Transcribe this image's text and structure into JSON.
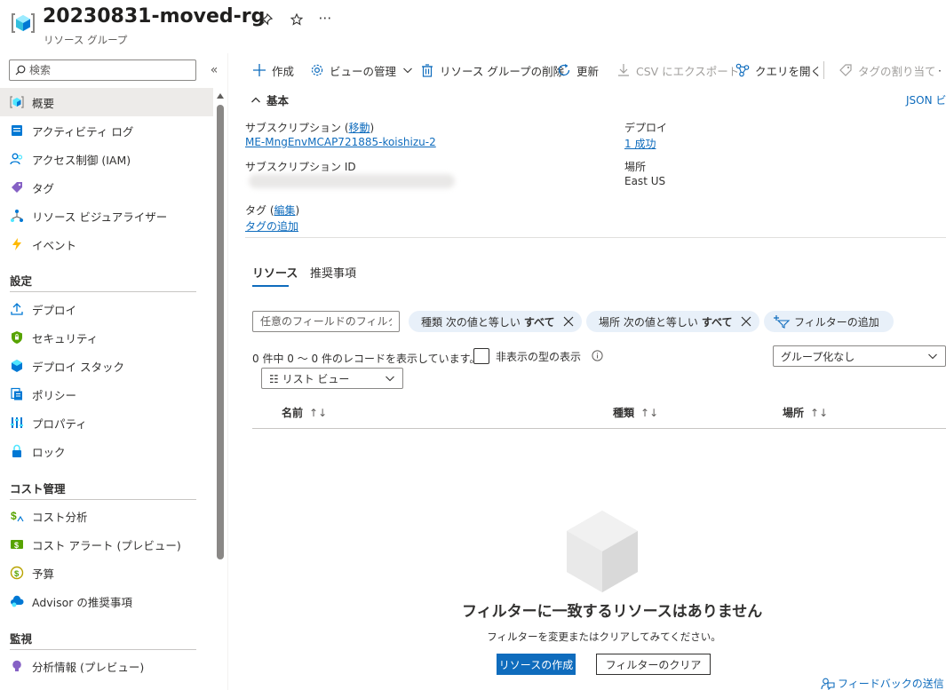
{
  "header": {
    "title": "20230831-moved-rg",
    "subtitle": "リソース グループ",
    "more": "⋯"
  },
  "sidebar": {
    "search_placeholder": "検索",
    "collapse": "«",
    "items": [
      {
        "label": "概要"
      },
      {
        "label": "アクティビティ ログ"
      },
      {
        "label": "アクセス制御 (IAM)"
      },
      {
        "label": "タグ"
      },
      {
        "label": "リソース ビジュアライザー"
      },
      {
        "label": "イベント"
      }
    ],
    "sections": [
      {
        "title": "設定",
        "items": [
          {
            "label": "デプロイ"
          },
          {
            "label": "セキュリティ"
          },
          {
            "label": "デプロイ スタック"
          },
          {
            "label": "ポリシー"
          },
          {
            "label": "プロパティ"
          },
          {
            "label": "ロック"
          }
        ]
      },
      {
        "title": "コスト管理",
        "items": [
          {
            "label": "コスト分析"
          },
          {
            "label": "コスト アラート (プレビュー)"
          },
          {
            "label": "予算"
          },
          {
            "label": "Advisor の推奨事項"
          }
        ]
      },
      {
        "title": "監視",
        "items": [
          {
            "label": "分析情報 (プレビュー)"
          }
        ]
      }
    ]
  },
  "toolbar": {
    "create": "作成",
    "manage_view": "ビューの管理",
    "delete_rg": "リソース グループの削除",
    "refresh": "更新",
    "export_csv": "CSV にエクスポート",
    "open_query": "クエリを開く",
    "assign_tags": "タグの割り当て",
    "more": "·"
  },
  "essentials": {
    "toggle_label": "基本",
    "json_view": "JSON ビ",
    "subscription_label": "サブスクリプション (",
    "subscription_move": "移動",
    "subscription_label_end": ")",
    "subscription_value": "ME-MngEnvMCAP721885-koishizu-2",
    "subscription_id_label": "サブスクリプション ID",
    "tags_label": "タグ (",
    "tags_edit": "編集",
    "tags_label_end": ")",
    "tags_add": "タグの追加",
    "deploy_label": "デプロイ",
    "deploy_value": "1 成功",
    "location_label": "場所",
    "location_value": "East US"
  },
  "tabs": [
    "リソース",
    "推奨事項"
  ],
  "filters": {
    "field_placeholder": "任意のフィールドのフィルター...",
    "pill_type": {
      "prefix": "種類 次の値と等しい",
      "value": "すべて"
    },
    "pill_location": {
      "prefix": "場所 次の値と等しい",
      "value": "すべて"
    },
    "add_filter": "フィルターの追加"
  },
  "list": {
    "records_text": "0 件中 0 ～ 0 件のレコードを表示しています。",
    "show_hidden": "非表示の型の表示",
    "grouping": "グループ化なし",
    "view_mode": "☷ リスト ビュー",
    "columns": [
      {
        "label": "名前",
        "arrow": "↑↓"
      },
      {
        "label": "種類",
        "arrow": "↑↓"
      },
      {
        "label": "場所",
        "arrow": "↑↓"
      }
    ]
  },
  "empty_state": {
    "title": "フィルターに一致するリソースはありません",
    "subtitle": "フィルターを変更またはクリアしてみてください。",
    "create_button": "リソースの作成",
    "clear_button": "フィルターのクリア"
  },
  "feedback": "フィードバックの送信",
  "colors": {
    "accent": "#0f6cbd",
    "pill_bg": "#e8f0f9",
    "nav_active": "#edebe9"
  }
}
